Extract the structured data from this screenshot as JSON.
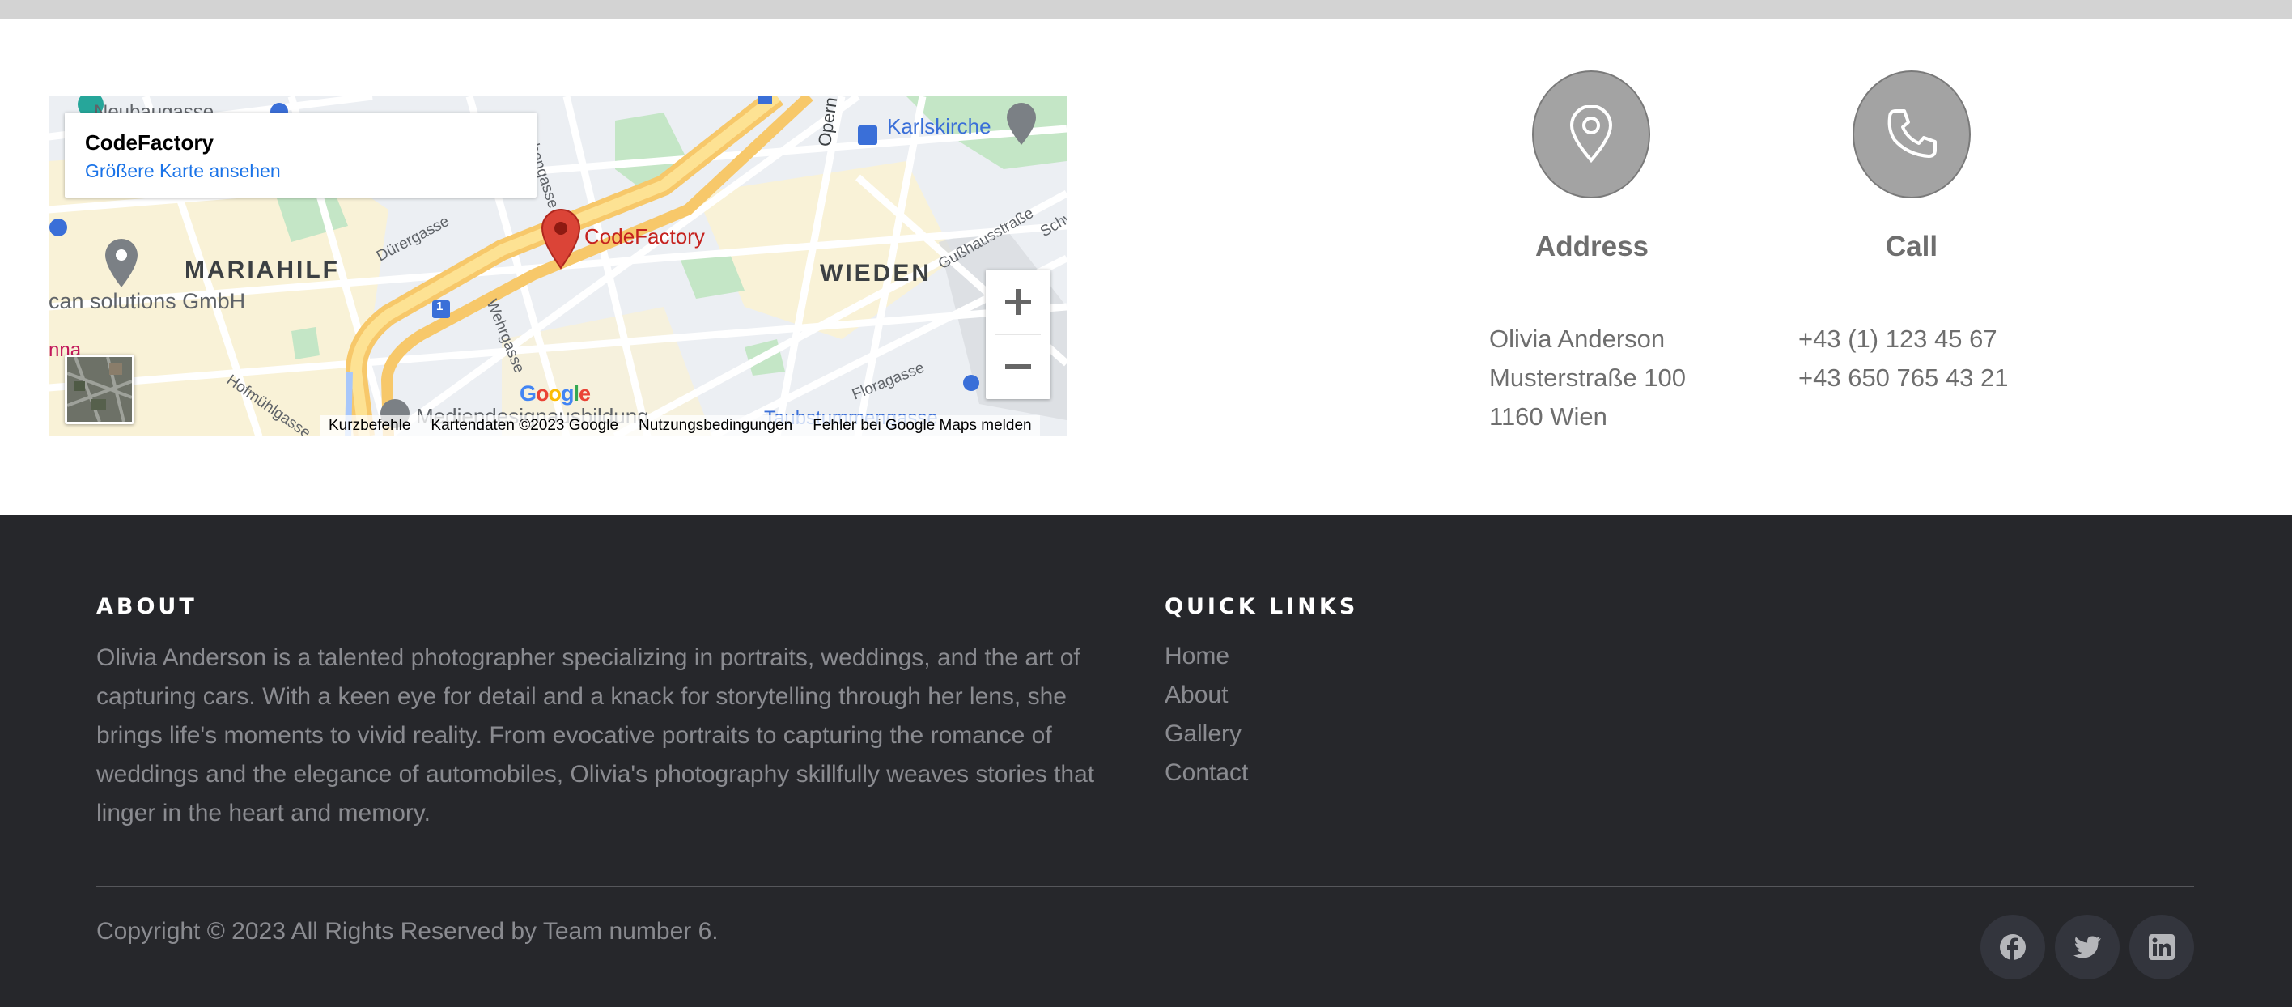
{
  "map": {
    "place_name": "CodeFactory",
    "larger_map_link": "Größere Karte ansehen",
    "marker_label": "CodeFactory",
    "districts": [
      "MARIAHILF",
      "WIEDEN"
    ],
    "labels": {
      "karlskirche": "Karlskirche",
      "company": "can solutions GmbH",
      "duerergasse": "Dürergasse",
      "wehrgasse": "Wehrgasse",
      "gusshausstrasse": "Gußhausstraße",
      "floragasse": "Floragasse",
      "hofmuehlgasse": "Hofmühlgasse",
      "oper": "Opern",
      "grubengasse": "grubengasse",
      "neubaugasse": "Neubaugasse",
      "mediendesign": "Mediendesignausbildung",
      "taubstummengasse": "Taubstummengasse",
      "schw": "Schw",
      "nna": "nna",
      "route_badge": "1"
    },
    "zoom_in": "+",
    "zoom_out": "−",
    "google_logo": "Google",
    "footer": [
      "Kurzbefehle",
      "Kartendaten ©2023 Google",
      "Nutzungsbedingungen",
      "Fehler bei Google Maps melden"
    ]
  },
  "contact": {
    "address": {
      "icon": "location-pin-icon",
      "title": "Address",
      "lines": [
        "Olivia Anderson",
        "Musterstraße 100",
        "1160 Wien"
      ]
    },
    "call": {
      "icon": "phone-icon",
      "title": "Call",
      "lines": [
        "+43 (1) 123 45 67",
        "+43 650 765 43 21"
      ]
    }
  },
  "footer": {
    "about_heading": "ABOUT",
    "about_text": "Olivia Anderson is a talented photographer specializing in portraits, weddings, and the art of capturing cars. With a keen eye for detail and a knack for storytelling through her lens, she brings life's moments to vivid reality. From evocative portraits to capturing the romance of weddings and the elegance of automobiles, Olivia's photography skillfully weaves stories that linger in the heart and memory.",
    "quick_links_heading": "QUICK LINKS",
    "quick_links": [
      "Home",
      "About",
      "Gallery",
      "Contact"
    ],
    "copyright": "Copyright © 2023 All Rights Reserved by Team number 6.",
    "social": [
      "facebook-icon",
      "twitter-icon",
      "linkedin-icon"
    ]
  },
  "colors": {
    "footer_bg": "#26272b",
    "link_blue": "#1a73e8",
    "marker_red": "#db4437",
    "circle_gray": "#a3a3a3"
  }
}
